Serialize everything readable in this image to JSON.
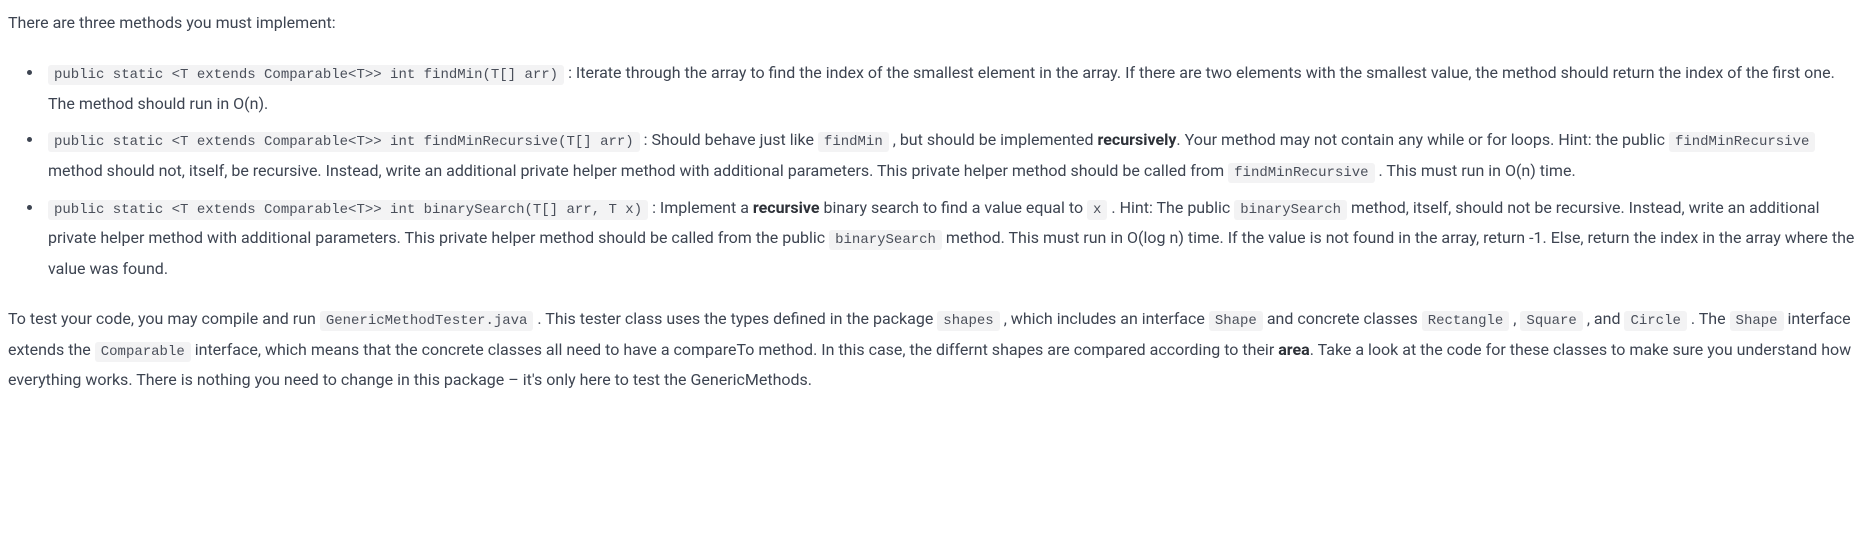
{
  "intro": "There are three methods you must implement:",
  "items": [
    {
      "sig": "public static <T extends Comparable<T>> int findMin(T[] arr)",
      "desc_a": " : Iterate through the array to find the index of the smallest element in the array. If there are two elements with the smallest value, the method should return the index of the first one. The method should run in O(n)."
    },
    {
      "sig": "public static <T extends Comparable<T>> int findMinRecursive(T[] arr)",
      "desc_a": " : Should behave just like ",
      "code_a": "findMin",
      "desc_b": " , but should be implemented ",
      "strong_a": "recursively",
      "desc_c": ". Your method may not contain any while or for loops. Hint: the public ",
      "code_b": "findMinRecursive",
      "desc_d": " method should not, itself, be recursive. Instead, write an additional private helper method with additional parameters. This private helper method should be called from ",
      "code_c": "findMinRecursive",
      "desc_e": " . This must run in O(n) time."
    },
    {
      "sig": "public static <T extends Comparable<T>> int binarySearch(T[] arr, T x)",
      "desc_a": " : Implement a ",
      "strong_a": "recursive",
      "desc_b": " binary search to find a value equal to ",
      "code_a": "x",
      "desc_c": " . Hint: The public ",
      "code_b": "binarySearch",
      "desc_d": " method, itself, should not be recursive. Instead, write an additional private helper method with additional parameters. This private helper method should be called from the public ",
      "code_c": "binarySearch",
      "desc_e": " method. This must run in O(log n) time. If the value is not found in the array, return -1. Else, return the index in the array where the value was found."
    }
  ],
  "outro": {
    "a": "To test your code, you may compile and run ",
    "code_a": "GenericMethodTester.java",
    "b": " . This tester class uses the types defined in the package ",
    "code_b": "shapes",
    "c": " , which includes an interface ",
    "code_c": "Shape",
    "d": " and concrete classes ",
    "code_d": "Rectangle",
    "e": " , ",
    "code_e": "Square",
    "f": " , and ",
    "code_f": "Circle",
    "g": " . The ",
    "code_g": "Shape",
    "h": " interface extends the ",
    "code_h": "Comparable",
    "i": " interface, which means that the concrete classes all need to have a compareTo method. In this case, the differnt shapes are compared according to their ",
    "strong_a": "area",
    "j": ". Take a look at the code for these classes to make sure you understand how everything works. There is nothing you need to change in this package – it's only here to test the GenericMethods."
  }
}
